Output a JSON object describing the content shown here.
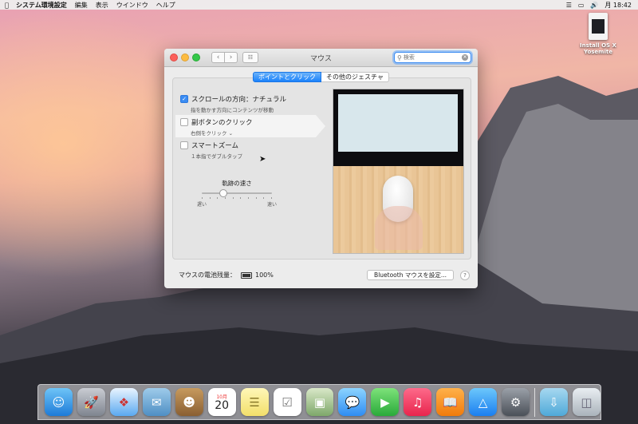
{
  "menubar": {
    "app_name": "システム環境設定",
    "items": [
      "編集",
      "表示",
      "ウインドウ",
      "ヘルプ"
    ],
    "clock": "月 18:42"
  },
  "desktop_icon": {
    "label_line1": "Install OS X",
    "label_line2": "Yosemite"
  },
  "window": {
    "title": "マウス",
    "search_placeholder": "検索",
    "tabs": [
      {
        "label": "ポイントとクリック",
        "active": true
      },
      {
        "label": "その他のジェスチャ",
        "active": false
      }
    ],
    "options": [
      {
        "label": "スクロールの方向：ナチュラル",
        "sub": "指を動かす方向にコンテンツが移動",
        "checked": true
      },
      {
        "label": "副ボタンのクリック",
        "sub": "右側をクリック ⌄",
        "checked": false
      },
      {
        "label": "スマートズーム",
        "sub": "１本指でダブルタップ",
        "checked": false
      }
    ],
    "tracking": {
      "label": "軌跡の速さ",
      "min_label": "遅い",
      "max_label": "速い",
      "value": 0.3
    },
    "battery_label": "マウスの電池残量：",
    "battery_value": "100%",
    "bluetooth_button": "Bluetooth マウスを設定...",
    "help": "?"
  },
  "dock": [
    "finder",
    "launchpad",
    "safari",
    "mail",
    "contacts",
    "calendar",
    "notes",
    "reminders",
    "photos",
    "messages",
    "facetime",
    "itunes",
    "ibooks",
    "app-store",
    "system-preferences",
    "downloads",
    "trash"
  ],
  "calendar_icon": {
    "month": "10月",
    "day": "20"
  },
  "colors": {
    "accent": "#1a82fb"
  }
}
